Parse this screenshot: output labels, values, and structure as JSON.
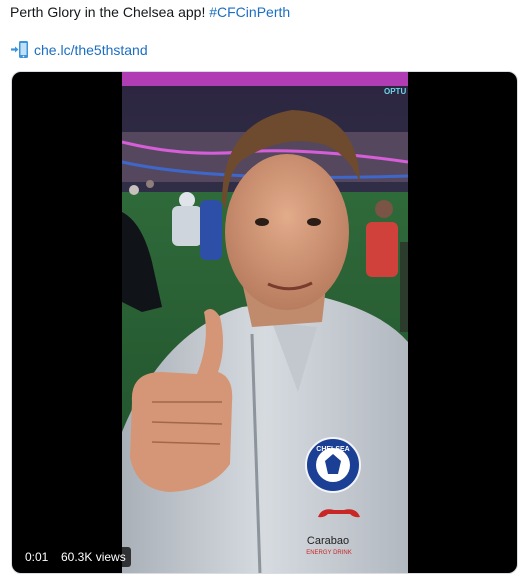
{
  "tweet": {
    "text": "Perth Glory in the Chelsea app! ",
    "hashtag": "#CFCinPerth"
  },
  "link": {
    "icon": "phone-arrow-icon",
    "text": "che.lc/the5thstand"
  },
  "video": {
    "elapsed": "0:01",
    "views": "60.3K views",
    "stadium_sign": "OPTU",
    "crest_text": "CHELSEA",
    "sponsor_text": "Carabao",
    "sponsor_sub": "ENERGY DRINK"
  },
  "colors": {
    "link_blue": "#1b6ec2",
    "jacket": "#c9ced4",
    "crest_blue": "#1a3f94"
  }
}
